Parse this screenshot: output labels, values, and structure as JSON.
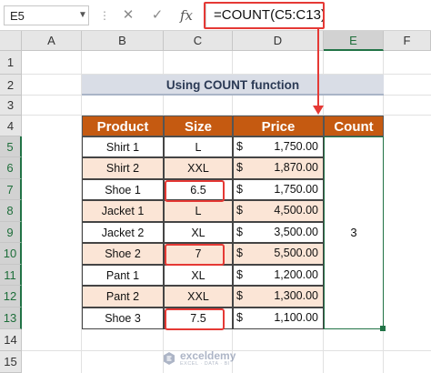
{
  "formula_bar": {
    "cell_ref": "E5",
    "cancel_icon": "✕",
    "enter_icon": "✓",
    "fx_label": "fx",
    "formula": "=COUNT(C5:C13)"
  },
  "columns": [
    "A",
    "B",
    "C",
    "D",
    "E",
    "F"
  ],
  "rows": [
    "1",
    "2",
    "3",
    "4",
    "5",
    "6",
    "7",
    "8",
    "9",
    "10",
    "11",
    "12",
    "13",
    "14",
    "15"
  ],
  "title": "Using COUNT function",
  "table": {
    "headers": [
      "Product",
      "Size",
      "Price",
      "Count"
    ],
    "rows": [
      {
        "product": "Shirt 1",
        "size": "L",
        "currency": "$",
        "price": "1,750.00"
      },
      {
        "product": "Shirt 2",
        "size": "XXL",
        "currency": "$",
        "price": "1,870.00"
      },
      {
        "product": "Shoe 1",
        "size": "6.5",
        "currency": "$",
        "price": "1,750.00"
      },
      {
        "product": "Jacket 1",
        "size": "L",
        "currency": "$",
        "price": "4,500.00"
      },
      {
        "product": "Jacket 2",
        "size": "XL",
        "currency": "$",
        "price": "3,500.00"
      },
      {
        "product": "Shoe 2",
        "size": "7",
        "currency": "$",
        "price": "5,500.00"
      },
      {
        "product": "Pant 1",
        "size": "XL",
        "currency": "$",
        "price": "1,200.00"
      },
      {
        "product": "Pant 2",
        "size": "XXL",
        "currency": "$",
        "price": "1,300.00"
      },
      {
        "product": "Shoe 3",
        "size": "7.5",
        "currency": "$",
        "price": "1,100.00"
      }
    ],
    "count_result": "3"
  },
  "colors": {
    "header_fill": "#c55a11",
    "row_alt_fill": "#fbe5d6",
    "highlight": "#e53935",
    "selection": "#217346"
  },
  "watermark": {
    "name": "exceldemy",
    "tagline": "EXCEL · DATA · BI"
  }
}
